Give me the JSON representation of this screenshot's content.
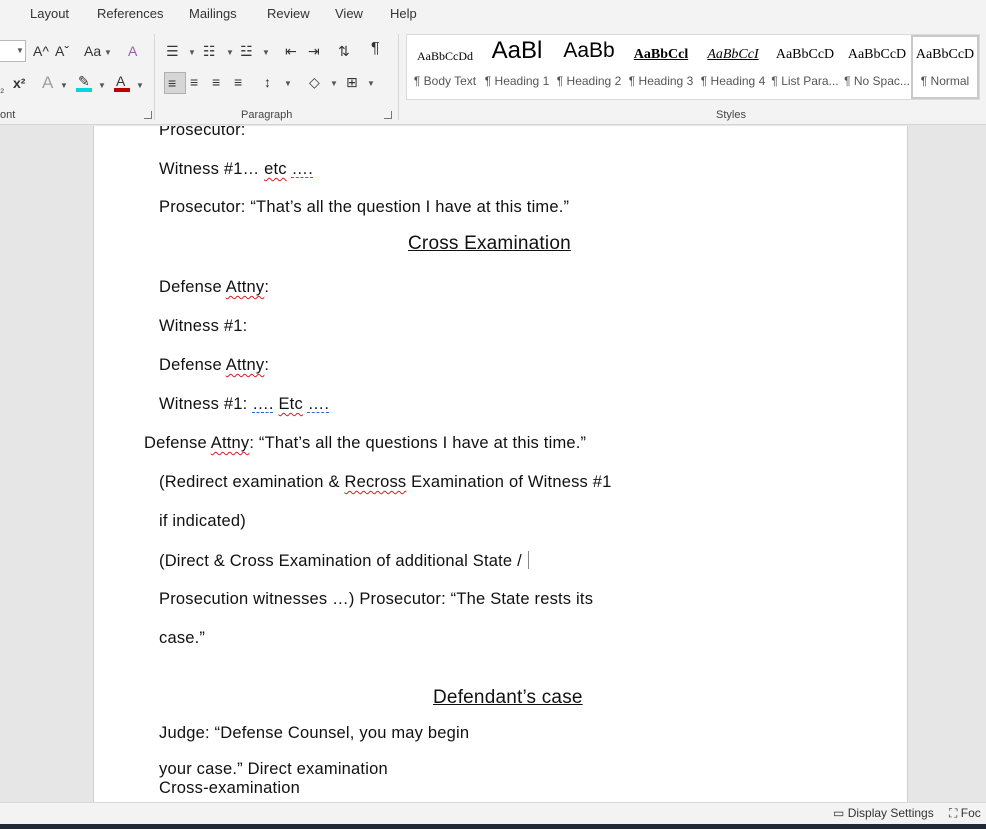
{
  "menu": {
    "tabs": [
      "Layout",
      "References",
      "Mailings",
      "Review",
      "View",
      "Help"
    ]
  },
  "ribbon": {
    "font_group_label": "ont",
    "paragraph_group_label": "Paragraph",
    "styles_group_label": "Styles",
    "font_buttons": {
      "grow": "A^",
      "shrink": "Aˇ",
      "change_case": "Aa",
      "clear_format": "A",
      "subscript": "₂",
      "superscript": "x²",
      "text_effects": "A",
      "highlight": "✎",
      "font_color": "A"
    },
    "font_color_hex": "#c00000",
    "highlight_color_hex": "#00d8e0",
    "styles": [
      {
        "preview": "AaBbCcDd",
        "name": "¶ Body Text"
      },
      {
        "preview": "AaBl",
        "name": "¶ Heading 1"
      },
      {
        "preview": "AaBb",
        "name": "¶ Heading 2"
      },
      {
        "preview": "AaBbCcl",
        "name": "¶ Heading 3"
      },
      {
        "preview": "AaBbCcI",
        "name": "¶ Heading 4"
      },
      {
        "preview": "AaBbCcD",
        "name": "¶ List Para..."
      },
      {
        "preview": "AaBbCcD",
        "name": "¶ No Spac..."
      },
      {
        "preview": "AaBbCcD",
        "name": "¶ Normal"
      }
    ]
  },
  "document": {
    "l1": "Prosecutor:",
    "l2a": "Witness #1… ",
    "l2b": "etc",
    "l2c": "….",
    "l3": "Prosecutor: “That’s all the question I have at this time.”",
    "h1": "Cross Examination",
    "l4a": "Defense ",
    "l4b": "Attny",
    "l4c": ":",
    "l5": "Witness #1:",
    "l6a": "Defense ",
    "l6b": "Attny",
    "l6c": ":",
    "l7a": "Witness #1: ",
    "l7b": "….",
    "l7c": "Etc",
    "l7d": "….",
    "l8a": "Defense ",
    "l8b": "Attny",
    "l8c": ": “That’s all the questions I have at this time.”",
    "l9a": "(Redirect examination & ",
    "l9b": "Recross",
    "l9c": " Examination of Witness #1",
    "l10": "if indicated)",
    "l11": "(Direct & Cross Examination of additional State /",
    "l12": "Prosecution witnesses …) Prosecutor: “The State rests its",
    "l13": "case.”",
    "h2": "Defendant’s case",
    "l14": "Judge: “Defense Counsel, you may begin",
    "l15": "your case.” Direct examination",
    "l16": "Cross-examination"
  },
  "status_bar": {
    "display_settings": "Display Settings",
    "focus": "Foc"
  }
}
